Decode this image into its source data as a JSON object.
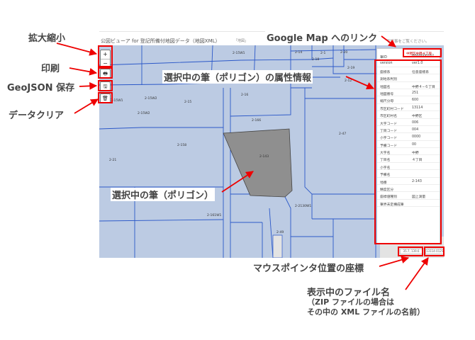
{
  "app": {
    "title": "公図ビューア for 登記所備付地図データ（地図XML）",
    "note": "「地図」",
    "note2": "で記事をご覧ください。"
  },
  "toolbar": {
    "zoom_in": "+",
    "zoom_out": "−",
    "print": "🖶",
    "save": "🖫",
    "clear": "🗑"
  },
  "map": {
    "parcel_labels": [
      "2-14",
      "2-15W1",
      "2-18",
      "2-16",
      "2-1",
      "2-20",
      "2-19",
      "2-12",
      "2-15W2",
      "2-15W2",
      "2-15W1",
      "2-15",
      "2-166",
      "2-158",
      "2-47",
      "2-143",
      "2-161W1",
      "2-2130W1",
      "2-49",
      "2-21"
    ],
    "selected_label": "2-143",
    "colors": {
      "background": "#bccbe3",
      "line": "#2b58c8",
      "selected_fill": "#8f8f8f",
      "gray_area": "#e3e3e3"
    }
  },
  "attributes": {
    "link": "中野区中野４丁目",
    "rows": [
      {
        "k": "筆ID",
        "v": "H000000162"
      },
      {
        "k": "version",
        "v": "ver1.0"
      },
      {
        "k": "座標系",
        "v": "任意座標系"
      },
      {
        "k": "測地系判別",
        "v": ""
      },
      {
        "k": "地図名",
        "v": "中野４−６丁目"
      },
      {
        "k": "地図番号",
        "v": "251"
      },
      {
        "k": "縮尺分母",
        "v": "600"
      },
      {
        "k": "市区町村コード",
        "v": "13114"
      },
      {
        "k": "市区町村名",
        "v": "中野区"
      },
      {
        "k": "大字コード",
        "v": "006"
      },
      {
        "k": "丁目コード",
        "v": "004"
      },
      {
        "k": "小字コード",
        "v": "0000"
      },
      {
        "k": "予備コード",
        "v": "00"
      },
      {
        "k": "大字名",
        "v": "中野"
      },
      {
        "k": "丁目名",
        "v": "４丁目"
      },
      {
        "k": "小字名",
        "v": ""
      },
      {
        "k": "予備名",
        "v": ""
      },
      {
        "k": "地番",
        "v": "2-143"
      },
      {
        "k": "精度区分",
        "v": ""
      },
      {
        "k": "座標値種別",
        "v": "図上測量"
      },
      {
        "k": "筆界未定構成筆",
        "v": ""
      }
    ]
  },
  "status": {
    "coords": "35.7, 139.6",
    "filename": "13114-0125.xml"
  },
  "annotations": {
    "zoom": "拡大縮小",
    "print": "印刷",
    "geojson": "GeoJSON 保存",
    "clear": "データクリア",
    "google_map": "Google Map へのリンク",
    "attributes": "選択中の筆（ポリゴン）の属性情報",
    "selected_polygon": "選択中の筆（ポリゴン）",
    "mouse_coords": "マウスポインタ位置の座標",
    "filename": "表示中のファイル名",
    "zip_note_1": "（ZIP ファイルの場合は",
    "zip_note_2": "その中の XML ファイルの名前）"
  }
}
